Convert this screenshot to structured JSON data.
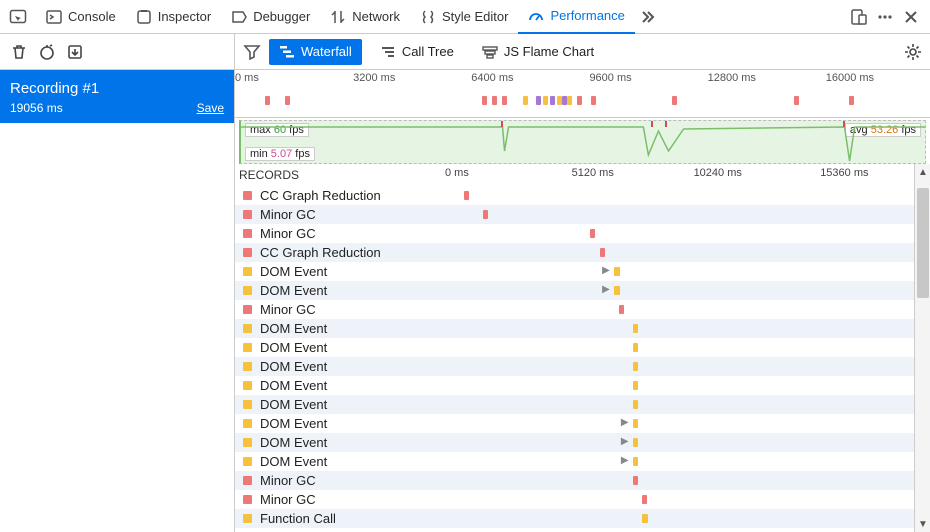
{
  "tabs": {
    "console": {
      "label": "Console"
    },
    "inspector": {
      "label": "Inspector"
    },
    "debugger": {
      "label": "Debugger"
    },
    "network": {
      "label": "Network"
    },
    "style_editor": {
      "label": "Style Editor"
    },
    "performance": {
      "label": "Performance"
    }
  },
  "sidebar": {
    "recording_title": "Recording #1",
    "recording_duration": "19056 ms",
    "save_label": "Save"
  },
  "views": {
    "waterfall": "Waterfall",
    "call_tree": "Call Tree",
    "flame_chart": "JS Flame Chart"
  },
  "overview_ticks": [
    "0 ms",
    "3200 ms",
    "6400 ms",
    "9600 ms",
    "12800 ms",
    "16000 ms"
  ],
  "overview_tick_positions_pct": [
    0,
    17,
    34,
    51,
    68,
    85
  ],
  "overview_markers": [
    {
      "t": "gc",
      "x": 2
    },
    {
      "t": "gc",
      "x": 5
    },
    {
      "t": "gc",
      "x": 34
    },
    {
      "t": "gc",
      "x": 35.5
    },
    {
      "t": "gc",
      "x": 37
    },
    {
      "t": "dom",
      "x": 40
    },
    {
      "t": "sty",
      "x": 42
    },
    {
      "t": "dom",
      "x": 43
    },
    {
      "t": "sty",
      "x": 44
    },
    {
      "t": "dom",
      "x": 45
    },
    {
      "t": "sty",
      "x": 45.8
    },
    {
      "t": "dom",
      "x": 46.5
    },
    {
      "t": "gc",
      "x": 48
    },
    {
      "t": "gc",
      "x": 50
    },
    {
      "t": "gc",
      "x": 62
    },
    {
      "t": "gc",
      "x": 80
    },
    {
      "t": "gc",
      "x": 88
    }
  ],
  "fps": {
    "max_value": "60",
    "min_value": "5.07",
    "avg_value": "53.26",
    "unit": "fps",
    "max_label": "max",
    "min_label": "min",
    "avg_label": "avg"
  },
  "records_header": "RECORDS",
  "record_ticks": [
    "0 ms",
    "5120 ms",
    "10240 ms",
    "15360 ms"
  ],
  "record_tick_positions_pct": [
    0,
    27,
    53,
    80
  ],
  "colors": {
    "gc": "#ee7777",
    "dom": "#f6c23e",
    "fn": "#f6c23e"
  },
  "records": [
    {
      "label": "CC Graph Reduction",
      "type": "gc",
      "pos": 4,
      "w": 5
    },
    {
      "label": "Minor GC",
      "type": "gc",
      "pos": 8,
      "w": 5
    },
    {
      "label": "Minor GC",
      "type": "gc",
      "pos": 31,
      "w": 5
    },
    {
      "label": "CC Graph Reduction",
      "type": "gc",
      "pos": 33,
      "w": 5
    },
    {
      "label": "DOM Event",
      "type": "dom",
      "pos": 36,
      "w": 6,
      "arrow": true
    },
    {
      "label": "DOM Event",
      "type": "dom",
      "pos": 36,
      "w": 6,
      "arrow": true
    },
    {
      "label": "Minor GC",
      "type": "gc",
      "pos": 37,
      "w": 5
    },
    {
      "label": "DOM Event",
      "type": "dom",
      "pos": 40,
      "w": 5
    },
    {
      "label": "DOM Event",
      "type": "dom",
      "pos": 40,
      "w": 5
    },
    {
      "label": "DOM Event",
      "type": "dom",
      "pos": 40,
      "w": 5
    },
    {
      "label": "DOM Event",
      "type": "dom",
      "pos": 40,
      "w": 5
    },
    {
      "label": "DOM Event",
      "type": "dom",
      "pos": 40,
      "w": 5
    },
    {
      "label": "DOM Event",
      "type": "dom",
      "pos": 40,
      "w": 5,
      "arrow": true
    },
    {
      "label": "DOM Event",
      "type": "dom",
      "pos": 40,
      "w": 5,
      "arrow": true
    },
    {
      "label": "DOM Event",
      "type": "dom",
      "pos": 40,
      "w": 5,
      "arrow": true
    },
    {
      "label": "Minor GC",
      "type": "gc",
      "pos": 40,
      "w": 5
    },
    {
      "label": "Minor GC",
      "type": "gc",
      "pos": 42,
      "w": 5
    },
    {
      "label": "Function Call",
      "type": "fn",
      "pos": 42,
      "w": 6
    }
  ]
}
